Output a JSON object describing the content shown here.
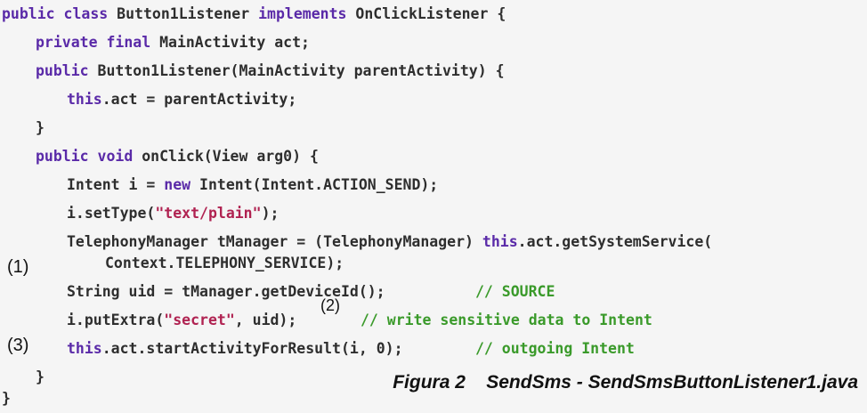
{
  "code": {
    "l1_kw1": "public class",
    "l1_t1": " Button1Listener ",
    "l1_kw2": "implements",
    "l1_t2": " OnClickListener {",
    "l2_kw": "private final",
    "l2_t": " MainActivity act;",
    "l3_kw": "public",
    "l3_t": " Button1Listener(MainActivity parentActivity) {",
    "l4_kw": "this",
    "l4_t": ".act = parentActivity;",
    "l5_t": "}",
    "l6_kw": "public void",
    "l6_t": " onClick(View arg0) {",
    "l7_t1": "Intent i = ",
    "l7_kw": "new",
    "l7_t2": " Intent(Intent.ACTION_SEND);",
    "l8_t1": "i.setType(",
    "l8_str": "\"text/plain\"",
    "l8_t2": ");",
    "l9_t1": "TelephonyManager tManager = (TelephonyManager) ",
    "l9_kw": "this",
    "l9_t2": ".act.getSystemService(",
    "l10_t": "Context.TELEPHONY_SERVICE);",
    "l11_t": "String uid = tManager.getDeviceId();",
    "l11_cm": "// SOURCE",
    "l12_t1": "i.putExtra(",
    "l12_str": "\"secret\"",
    "l12_t2": ", uid);",
    "l12_cm": "// write sensitive data to Intent",
    "l13_kw": "this",
    "l13_t": ".act.startActivityForResult(i, 0);",
    "l13_cm": "// outgoing Intent",
    "l14_t": "}",
    "l15_t": "}"
  },
  "markers": {
    "m1": "(1)",
    "m2": "(2)",
    "m3": "(3)"
  },
  "caption": "Figura 2    SendSms - SendSmsButtonListener1.java"
}
